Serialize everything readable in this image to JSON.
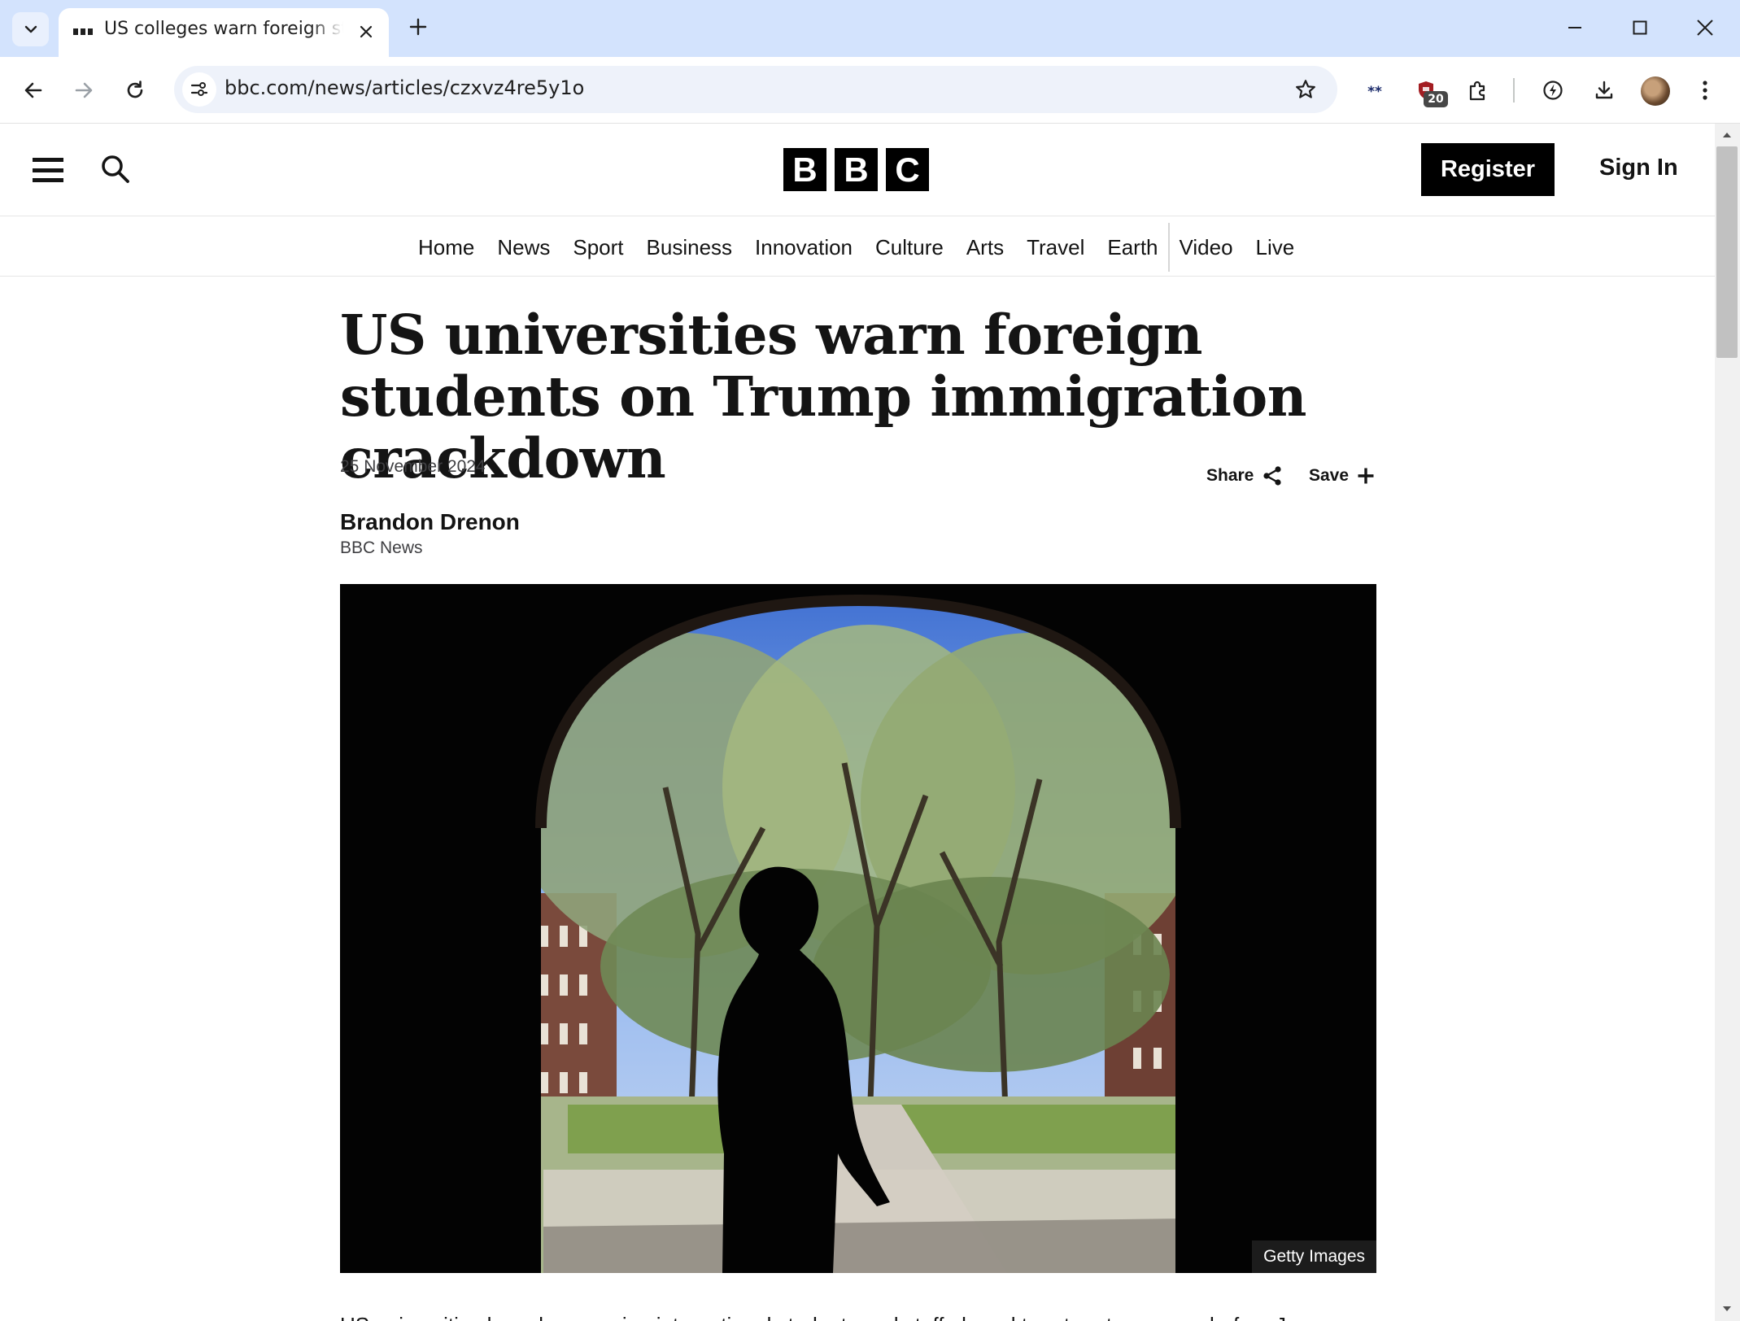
{
  "browser": {
    "tab": {
      "title": "US colleges warn foreign students on Trump immigration crackdown",
      "close_icon": "close-icon"
    },
    "url": "bbc.com/news/articles/czxvz4re5y1o",
    "extension_badge": "20",
    "icons": [
      "tab-search-icon",
      "new-tab-icon",
      "minimize-icon",
      "maximize-icon",
      "window-close-icon",
      "back-icon",
      "forward-icon",
      "reload-icon",
      "site-info-icon",
      "bookmark-star-icon",
      "extension-asterisk-icon",
      "extension-shield-icon",
      "extensions-puzzle-icon",
      "performance-icon",
      "download-icon",
      "profile-avatar",
      "more-menu-icon"
    ]
  },
  "site": {
    "logo_letters": [
      "B",
      "B",
      "C"
    ],
    "register_label": "Register",
    "signin_label": "Sign In",
    "nav": [
      "Home",
      "News",
      "Sport",
      "Business",
      "Innovation",
      "Culture",
      "Arts",
      "Travel",
      "Earth",
      "Video",
      "Live"
    ]
  },
  "article": {
    "headline": "US universities warn foreign students on Trump immigration crackdown",
    "date": "25 November 2024",
    "share_label": "Share",
    "save_label": "Save",
    "author": "Brandon Drenon",
    "organisation": "BBC News",
    "image_credit": "Getty Images",
    "first_paragraph_clipped": "US universities have been urging international students and staff abroad to return to campus before January"
  },
  "colors": {
    "tabstrip": "#d3e3fd",
    "omnibox": "#eef2fa",
    "bbc_black": "#000000",
    "text": "#141414"
  }
}
